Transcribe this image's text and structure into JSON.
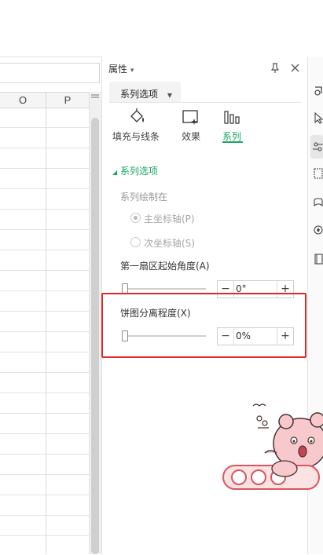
{
  "sheet": {
    "columns": [
      {
        "label": "O"
      },
      {
        "label": "P"
      }
    ]
  },
  "panel": {
    "title": "属性",
    "title_caret": "▾",
    "pin_icon": "pin-icon",
    "close_icon": "close-icon",
    "series_tab": {
      "label": "系列选项",
      "caret": "▼"
    },
    "tabs": [
      {
        "label": "填充与线条",
        "icon": "paint-bucket-icon"
      },
      {
        "label": "效果",
        "icon": "effects-icon"
      },
      {
        "label": "系列",
        "icon": "bar-chart-icon",
        "active": true
      }
    ],
    "section": {
      "label": "系列选项",
      "expanded_marker": "◢"
    },
    "draw_on": {
      "label": "系列绘制在",
      "options": [
        {
          "label": "主坐标轴(P)",
          "selected": true,
          "enabled": false
        },
        {
          "label": "次坐标轴(S)",
          "selected": false,
          "enabled": false
        }
      ]
    },
    "first_slice_angle": {
      "label": "第一扇区起始角度(A)",
      "value": "0°",
      "minus": "−",
      "plus": "+",
      "level": 0
    },
    "explosion": {
      "label": "饼图分离程度(X)",
      "value": "0%",
      "minus": "−",
      "plus": "+",
      "level": 0
    }
  },
  "side_toolbar": {
    "icons": [
      "shapes-icon",
      "cursor-icon",
      "settings-sliders-icon",
      "grid-icon",
      "gamepad-icon",
      "location-icon",
      "book-icon"
    ],
    "active_index": 2
  },
  "accent_color": "#1aa563",
  "highlight_color": "#e0282b"
}
